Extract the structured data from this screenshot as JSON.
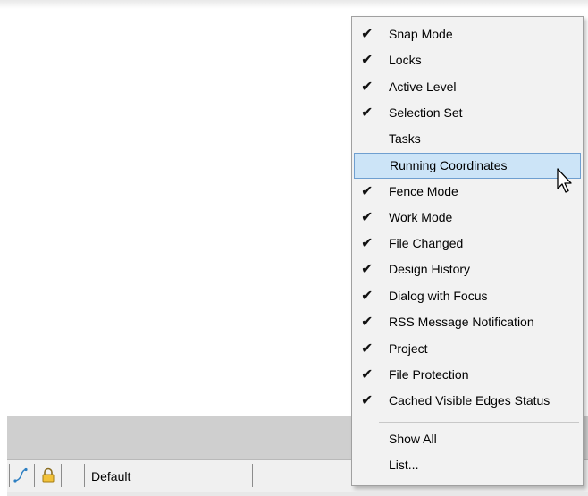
{
  "statusbar": {
    "level_text": "Default"
  },
  "context_menu": {
    "items": [
      {
        "label": "Snap Mode",
        "checked": true
      },
      {
        "label": "Locks",
        "checked": true
      },
      {
        "label": "Active Level",
        "checked": true
      },
      {
        "label": "Selection Set",
        "checked": true
      },
      {
        "label": "Tasks",
        "checked": false
      },
      {
        "label": "Running Coordinates",
        "checked": false,
        "highlighted": true
      },
      {
        "label": "Fence Mode",
        "checked": true
      },
      {
        "label": "Work Mode",
        "checked": true
      },
      {
        "label": "File Changed",
        "checked": true
      },
      {
        "label": "Design History",
        "checked": true
      },
      {
        "label": "Dialog with Focus",
        "checked": true
      },
      {
        "label": "RSS Message Notification",
        "checked": true
      },
      {
        "label": "Project",
        "checked": true
      },
      {
        "label": "File Protection",
        "checked": true
      },
      {
        "label": "Cached Visible Edges Status",
        "checked": true
      }
    ],
    "footer_items": [
      {
        "label": "Show All"
      },
      {
        "label": "List..."
      }
    ],
    "check_glyph": "✔"
  },
  "colors": {
    "highlight_bg": "#cce4f7",
    "highlight_border": "#6f9fd0",
    "menu_bg": "#f2f2f2"
  }
}
